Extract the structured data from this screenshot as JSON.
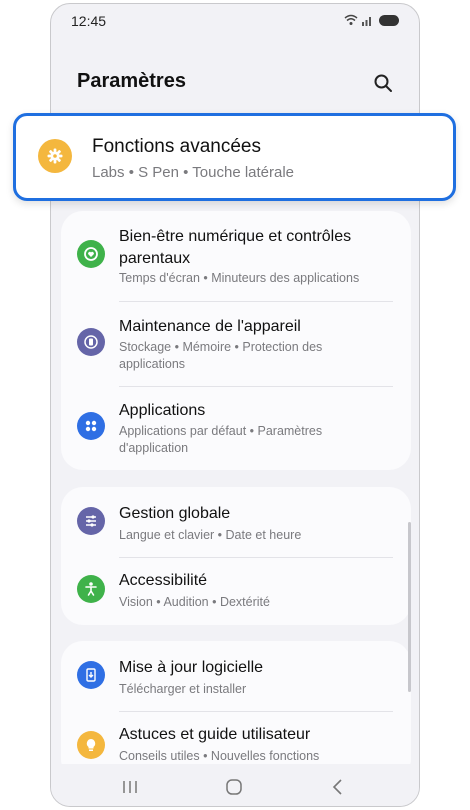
{
  "status_bar": {
    "time": "12:45"
  },
  "header": {
    "title": "Paramètres"
  },
  "highlight": {
    "title": "Fonctions avancées",
    "subtitle": "Labs  •  S Pen  •  Touche latérale"
  },
  "group1": [
    {
      "title": "Bien-être numérique et contrôles parentaux",
      "subtitle": "Temps d'écran  •  Minuteurs des applications",
      "icon": "digital-wellbeing-icon",
      "color": "#3fb24a"
    },
    {
      "title": "Maintenance de l'appareil",
      "subtitle": "Stockage  •  Mémoire  •  Protection des applications",
      "icon": "device-care-icon",
      "color": "#6565a8"
    },
    {
      "title": "Applications",
      "subtitle": "Applications par défaut  •  Paramètres d'application",
      "icon": "apps-icon",
      "color": "#2f6fe4"
    }
  ],
  "group2": [
    {
      "title": "Gestion globale",
      "subtitle": "Langue et clavier  •  Date et heure",
      "icon": "sliders-icon",
      "color": "#6565a8"
    },
    {
      "title": "Accessibilité",
      "subtitle": "Vision  •  Audition  •  Dextérité",
      "icon": "accessibility-icon",
      "color": "#3fb24a"
    }
  ],
  "group3": [
    {
      "title": "Mise à jour logicielle",
      "subtitle": "Télécharger et installer",
      "icon": "software-update-icon",
      "color": "#2f6fe4"
    },
    {
      "title": "Astuces et guide utilisateur",
      "subtitle": "Conseils utiles  •  Nouvelles fonctions",
      "icon": "lightbulb-icon",
      "color": "#f4b73e"
    }
  ],
  "colors": {
    "accent_outline": "#1f6fe0",
    "advanced_icon": "#f4b73e",
    "background": "#f2f2f6"
  },
  "nav_icons": [
    "recent-apps-icon",
    "home-icon",
    "back-icon"
  ]
}
